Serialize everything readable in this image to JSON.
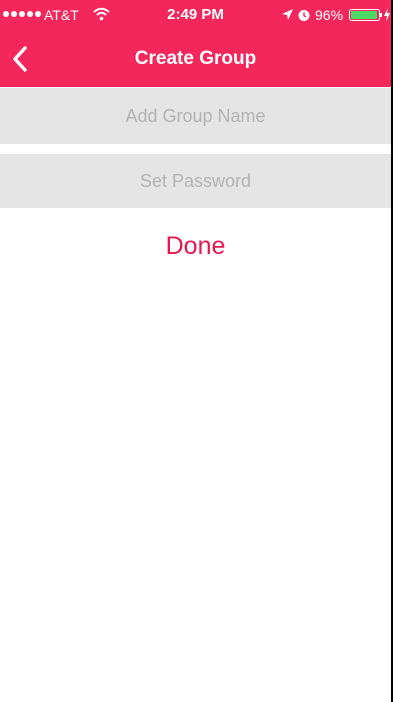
{
  "colors": {
    "accent": "#f3275b",
    "done_text": "#e8174d",
    "field_background": "#e5e5e5",
    "placeholder_text": "#b3b3b3"
  },
  "status_bar": {
    "carrier": "AT&T",
    "time": "2:49 PM",
    "battery_percent": "96%",
    "battery_level": 0.96,
    "icons": [
      "signal-dots-icon",
      "wifi-icon",
      "location-arrow-icon",
      "alarm-clock-icon",
      "battery-icon",
      "charging-bolt-icon"
    ]
  },
  "nav": {
    "title": "Create Group",
    "back_icon": "chevron-left-icon"
  },
  "form": {
    "group_name": {
      "value": "",
      "placeholder": "Add Group Name"
    },
    "password": {
      "value": "",
      "placeholder": "Set Password"
    },
    "done_label": "Done"
  }
}
